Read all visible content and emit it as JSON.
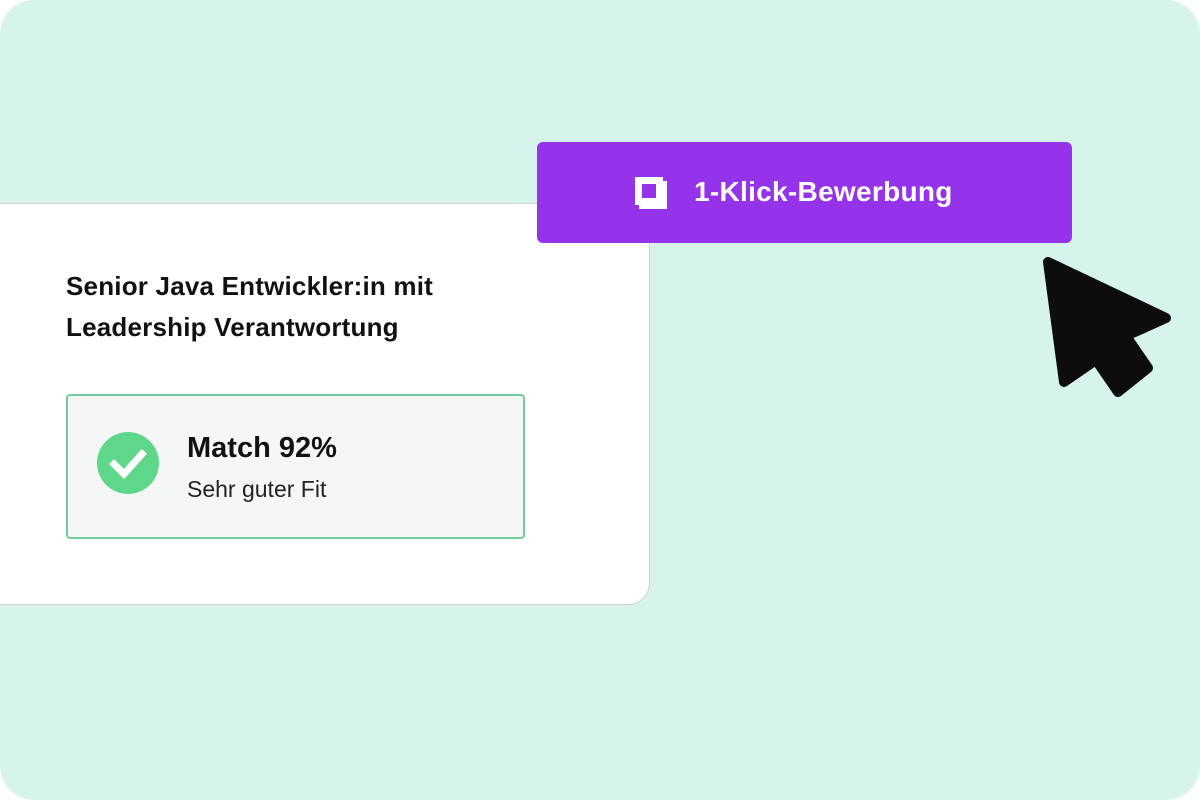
{
  "job_card": {
    "title": "Senior Java Entwickler:in mit Leadership Verantwortung",
    "match": {
      "title": "Match 92%",
      "percent": 92,
      "subtitle": "Sehr guter Fit",
      "icon": "check-circle-icon",
      "accent_color": "#5fd78a"
    }
  },
  "apply_button": {
    "label": "1-Klick-Bewerbung",
    "icon": "square-icon",
    "color": "#9433ea"
  },
  "cursor": {
    "icon": "mouse-pointer-icon"
  },
  "colors": {
    "background": "#d6f4ec",
    "card": "#ffffff",
    "match_border": "#6fcf97"
  }
}
